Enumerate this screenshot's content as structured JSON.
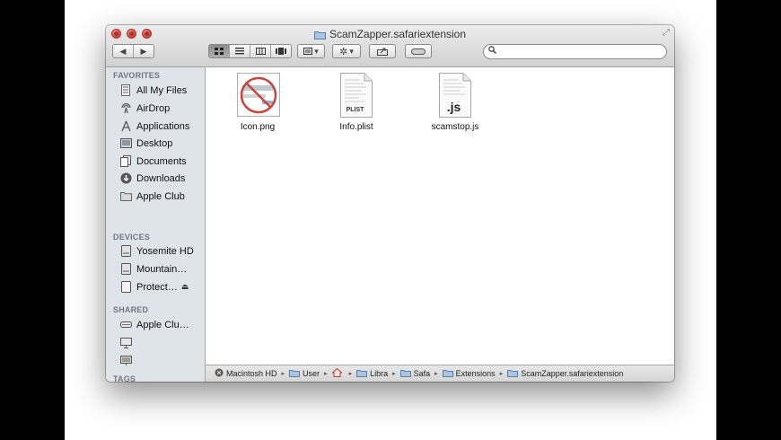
{
  "window": {
    "title": "ScamZapper.safariextension"
  },
  "toolbar": {
    "nav_back": "◀",
    "nav_forward": "▶",
    "views": [
      "icon-view",
      "list-view",
      "column-view",
      "coverflow-view"
    ],
    "arrange_label": "▾",
    "action_label": "▾",
    "search_placeholder": ""
  },
  "sidebar": {
    "favorites_header": "FAVORITES",
    "favorites": [
      {
        "label": "All My Files",
        "icon": "all-files-icon"
      },
      {
        "label": "AirDrop",
        "icon": "airdrop-icon"
      },
      {
        "label": "Applications",
        "icon": "applications-icon"
      },
      {
        "label": "Desktop",
        "icon": "desktop-icon"
      },
      {
        "label": "Documents",
        "icon": "documents-icon"
      },
      {
        "label": "Downloads",
        "icon": "downloads-icon"
      },
      {
        "label": "Apple Club",
        "icon": "folder-icon"
      }
    ],
    "devices_header": "DEVICES",
    "devices": [
      {
        "label": "Yosemite HD",
        "icon": "hard-drive-icon"
      },
      {
        "label": "Mountain…",
        "icon": "hard-drive-icon"
      },
      {
        "label": "Protect…",
        "icon": "disk-image-icon",
        "eject": "⏏"
      }
    ],
    "shared_header": "SHARED",
    "shared": [
      {
        "label": "Apple Clu…",
        "icon": "network-drive-icon"
      },
      {
        "label": "",
        "icon": "display-icon"
      },
      {
        "label": "",
        "icon": "server-icon"
      }
    ],
    "tags_header": "TAGS"
  },
  "files": [
    {
      "name": "Icon.png",
      "type": "png",
      "badge": ""
    },
    {
      "name": "Info.plist",
      "type": "plist",
      "badge": "PLIST"
    },
    {
      "name": "scamstop.js",
      "type": "js",
      "badge": ".js"
    }
  ],
  "pathbar": {
    "items": [
      "Macintosh HD",
      "User",
      "",
      "Libra",
      "Safa",
      "Extensions",
      "ScamZapper.safariextension"
    ]
  },
  "colors": {
    "sidebar_bg": "#dfe4ea",
    "traffic_red": "#d9473e",
    "toolbar_bg": "#d2d2d2"
  }
}
